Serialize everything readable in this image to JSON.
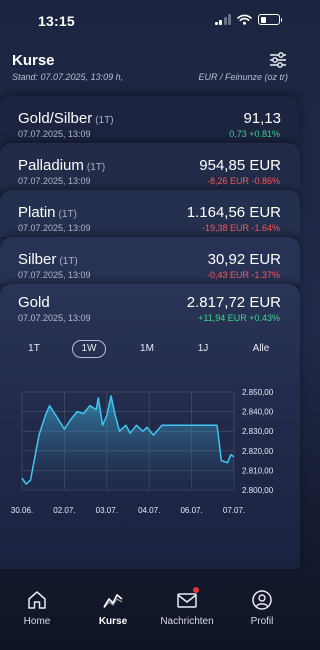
{
  "status": {
    "time": "13:15"
  },
  "header": {
    "title": "Kurse",
    "stand": "Stand: 07.07.2025, 13:09 h,",
    "unit": "EUR / Feinunze (oz tr)",
    "filter_icon": "sliders-icon"
  },
  "rows": [
    {
      "name": "Gold/Silber",
      "period": "(1T)",
      "date": "07.07.2025, 13:09",
      "price": "91,13",
      "change": "0,73 +0.81%",
      "trend": "pos",
      "bg": "#1c2440"
    },
    {
      "name": "Palladium",
      "period": "(1T)",
      "date": "07.07.2025, 13:09",
      "price": "954,85 EUR",
      "change": "-8,26 EUR -0.86%",
      "trend": "neg",
      "bg": "#222b48"
    },
    {
      "name": "Platin",
      "period": "(1T)",
      "date": "07.07.2025, 13:09",
      "price": "1.164,56 EUR",
      "change": "-19,38 EUR -1.64%",
      "trend": "neg",
      "bg": "#252f4e"
    },
    {
      "name": "Silber",
      "period": "(1T)",
      "date": "07.07.2025, 13:09",
      "price": "30,92 EUR",
      "change": "-0,43 EUR -1.37%",
      "trend": "neg",
      "bg": "#283254"
    }
  ],
  "gold": {
    "name": "Gold",
    "date": "07.07.2025, 13:09",
    "price": "2.817,72 EUR",
    "change": "+11,94 EUR +0.43%"
  },
  "ranges": [
    "1T",
    "1W",
    "1M",
    "1J",
    "Alle"
  ],
  "active_range": "1W",
  "colors": {
    "positive": "#39d889",
    "negative": "#ff5a5a",
    "line": "#3fc6f0",
    "badge": "#e63238"
  },
  "chart_data": {
    "type": "area",
    "x_ticks": [
      "30.06.",
      "02.07.",
      "03.07.",
      "04.07.",
      "06.07.",
      "07.07."
    ],
    "y_ticks": [
      "2.850,00",
      "2.840,00",
      "2.830,00",
      "2.820,00",
      "2.810,00",
      "2.800,00"
    ],
    "ylim": [
      2800,
      2850
    ],
    "grid": true,
    "points": [
      [
        0.0,
        2806
      ],
      [
        0.02,
        2803
      ],
      [
        0.04,
        2805
      ],
      [
        0.08,
        2828
      ],
      [
        0.11,
        2838
      ],
      [
        0.13,
        2843
      ],
      [
        0.16,
        2838
      ],
      [
        0.2,
        2831
      ],
      [
        0.23,
        2836
      ],
      [
        0.26,
        2840
      ],
      [
        0.29,
        2839
      ],
      [
        0.32,
        2843
      ],
      [
        0.35,
        2841
      ],
      [
        0.36,
        2847
      ],
      [
        0.38,
        2833
      ],
      [
        0.4,
        2838
      ],
      [
        0.42,
        2848
      ],
      [
        0.44,
        2838
      ],
      [
        0.46,
        2830
      ],
      [
        0.49,
        2833
      ],
      [
        0.51,
        2829
      ],
      [
        0.54,
        2833
      ],
      [
        0.57,
        2830
      ],
      [
        0.59,
        2832
      ],
      [
        0.62,
        2828
      ],
      [
        0.66,
        2833
      ],
      [
        0.72,
        2833
      ],
      [
        0.8,
        2833
      ],
      [
        0.87,
        2833
      ],
      [
        0.92,
        2833
      ],
      [
        0.93,
        2824
      ],
      [
        0.94,
        2815
      ],
      [
        0.97,
        2814
      ],
      [
        0.985,
        2818
      ],
      [
        1.0,
        2817
      ]
    ]
  },
  "tabs": [
    {
      "id": "home",
      "label": "Home",
      "icon": "home-icon"
    },
    {
      "id": "kurse",
      "label": "Kurse",
      "icon": "chart-line-icon"
    },
    {
      "id": "nachrichten",
      "label": "Nachrichten",
      "icon": "mail-icon"
    },
    {
      "id": "profil",
      "label": "Profil",
      "icon": "profile-icon"
    }
  ]
}
